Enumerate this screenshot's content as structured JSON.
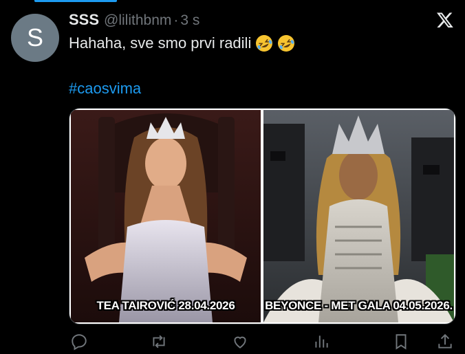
{
  "tweet": {
    "avatar_letter": "S",
    "display_name": "SSS",
    "handle": "@lilithbnm",
    "separator": "·",
    "time": "3 s",
    "text": "Hahaha, sve smo prvi radili",
    "emojis": [
      "rolling-on-floor-laughing-emoji",
      "rolling-on-floor-laughing-emoji"
    ],
    "hashtag": "#caosvima"
  },
  "media": {
    "left_caption": "TEA TAIROVIĆ 28.04.2026",
    "right_caption": "BEYONCE - MET GALA 04.05.2026."
  },
  "actions": [
    "reply-icon",
    "retweet-icon",
    "like-icon",
    "views-icon",
    "bookmark-icon",
    "share-icon"
  ],
  "colors": {
    "background": "#000000",
    "text": "#e7e9ea",
    "secondary": "#71767b",
    "accent": "#1d9bf0",
    "avatar": "#6b7a85"
  }
}
